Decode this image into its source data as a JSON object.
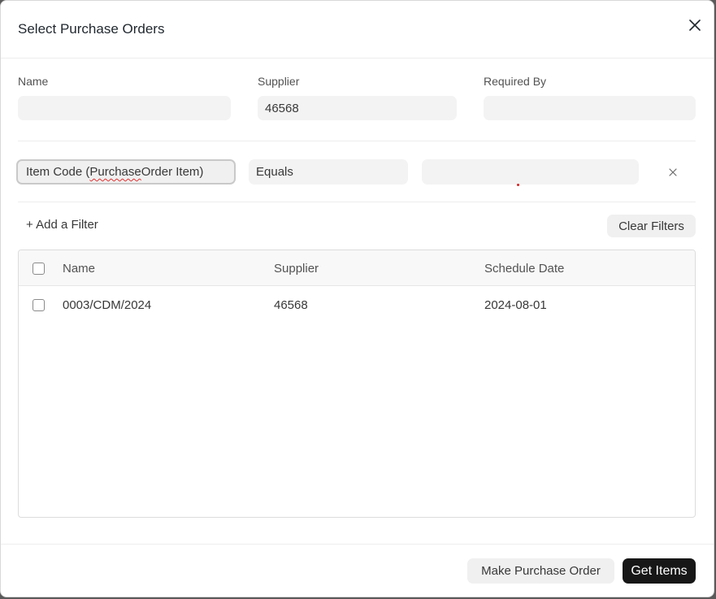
{
  "dialog": {
    "title": "Select Purchase Orders",
    "close_icon": "close-icon"
  },
  "fields": {
    "name": {
      "label": "Name",
      "value": ""
    },
    "supplier": {
      "label": "Supplier",
      "value": "46568"
    },
    "required_by": {
      "label": "Required By",
      "value": ""
    }
  },
  "filter": {
    "fieldname_before": "Item Code (",
    "fieldname_spell": "Purchase",
    "fieldname_after": " Order Item)",
    "condition": "Equals",
    "value": "",
    "remove_icon": "close-icon"
  },
  "filter_actions": {
    "add_filter": "+ Add a Filter",
    "clear_filters": "Clear Filters"
  },
  "results": {
    "columns": [
      "Name",
      "Supplier",
      "Schedule Date"
    ],
    "rows": [
      {
        "name": "0003/CDM/2024",
        "supplier": "46568",
        "schedule_date": "2024-08-01"
      }
    ]
  },
  "footer": {
    "secondary_action": "Make Purchase Order",
    "primary_action": "Get Items"
  },
  "colors": {
    "primary_button": "#171717",
    "input_background": "#f3f3f3",
    "spellcheck_underline": "#e03030"
  }
}
